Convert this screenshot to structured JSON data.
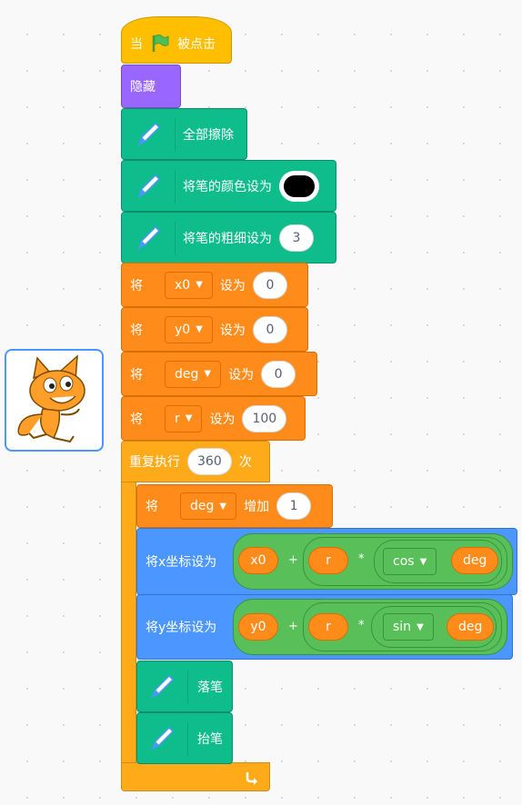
{
  "sprite": {
    "name": "cat-sprite",
    "icon": "scratch-cat"
  },
  "colors": {
    "event": "#ffbf00",
    "looks": "#9966ff",
    "pen": "#0fbd8c",
    "variables": "#ff8c1a",
    "control": "#ffab19",
    "motion": "#4c97ff",
    "operators": "#59c059"
  },
  "script": {
    "hat": {
      "prefix": "当",
      "flag_icon": "green-flag-icon",
      "suffix": "被点击"
    },
    "hide": "隐藏",
    "erase_all": "全部擦除",
    "set_pen_color": {
      "label": "将笔的颜色设为",
      "color": "#000000"
    },
    "set_pen_size": {
      "label": "将笔的粗细设为",
      "value": "3"
    },
    "set_vars": [
      {
        "prefix": "将",
        "var": "x0",
        "mid": "设为",
        "value": "0"
      },
      {
        "prefix": "将",
        "var": "y0",
        "mid": "设为",
        "value": "0"
      },
      {
        "prefix": "将",
        "var": "deg",
        "mid": "设为",
        "value": "0"
      },
      {
        "prefix": "将",
        "var": "r",
        "mid": "设为",
        "value": "100"
      }
    ],
    "repeat": {
      "label": "重复执行",
      "times": "360",
      "suffix": "次"
    },
    "change_var": {
      "prefix": "将",
      "var": "deg",
      "mid": "增加",
      "value": "1"
    },
    "set_x": {
      "label": "将x坐标设为",
      "a": "x0",
      "plus": "+",
      "b": "r",
      "times": "*",
      "fn": "cos",
      "arg": "deg"
    },
    "set_y": {
      "label": "将y坐标设为",
      "a": "y0",
      "plus": "+",
      "b": "r",
      "times": "*",
      "fn": "sin",
      "arg": "deg"
    },
    "pen_down": "落笔",
    "pen_up": "抬笔",
    "loop_icon": "loop-arrow-icon"
  }
}
